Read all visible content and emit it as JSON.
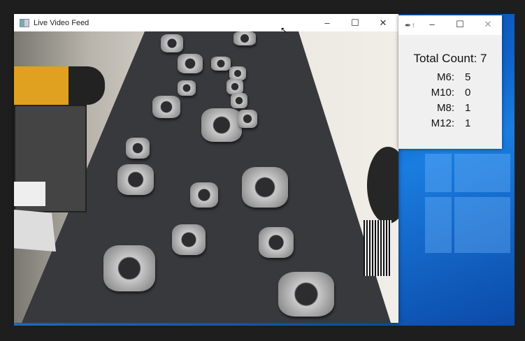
{
  "video_window": {
    "title": "Live Video Feed",
    "icon": "app-icon",
    "controls": {
      "minimize": "–",
      "maximize": "☐",
      "close": "✕"
    }
  },
  "counter_window": {
    "title_abbrev": "t",
    "controls": {
      "minimize": "–",
      "maximize": "☐",
      "close": "✕"
    },
    "total_label": "Total Count: 7",
    "counts": [
      {
        "label": "M6:",
        "value": "5"
      },
      {
        "label": "M10:",
        "value": "0"
      },
      {
        "label": "M8:",
        "value": "1"
      },
      {
        "label": "M12:",
        "value": "1"
      }
    ]
  }
}
